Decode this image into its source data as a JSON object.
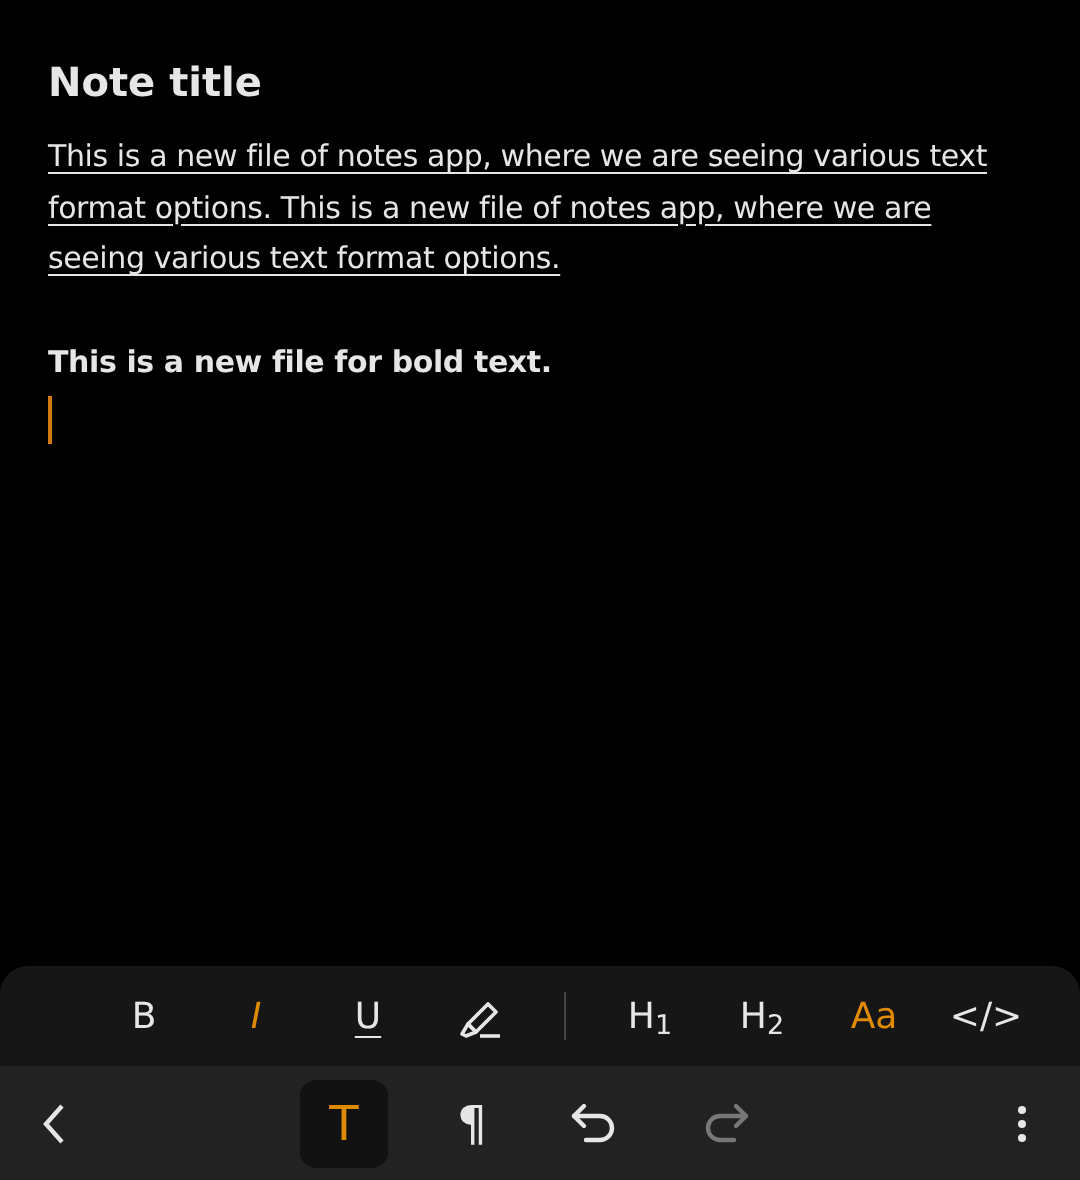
{
  "note": {
    "title": "Note title",
    "paragraphs": [
      {
        "kind": "underlined",
        "text": "This is a new file of notes app, where we are seeing various text format options. This is a new file of notes app, where we are seeing various text format options."
      },
      {
        "kind": "bold",
        "text": "This is a new file for bold text."
      }
    ],
    "cursor": true
  },
  "format_toolbar": {
    "items": [
      {
        "kind": "text",
        "label": "B",
        "active": false
      },
      {
        "kind": "text",
        "label": "I",
        "active": true
      },
      {
        "kind": "text",
        "label": "U",
        "active": false
      },
      {
        "kind": "highlighter",
        "active": false
      },
      {
        "kind": "divider"
      },
      {
        "kind": "text",
        "label": "H$_{1}$",
        "active": false
      },
      {
        "kind": "text",
        "label": "H$_{2}$",
        "active": false
      },
      {
        "kind": "text",
        "label": "Aa",
        "active": true
      },
      {
        "kind": "text",
        "label": "</>",
        "active": false
      }
    ]
  },
  "bottom_bar": {
    "tabs": [
      {
        "label": "T",
        "selected": true
      },
      {
        "label": "¶",
        "selected": false
      }
    ],
    "undo": {
      "disabled": false
    },
    "redo": {
      "disabled": true
    }
  }
}
